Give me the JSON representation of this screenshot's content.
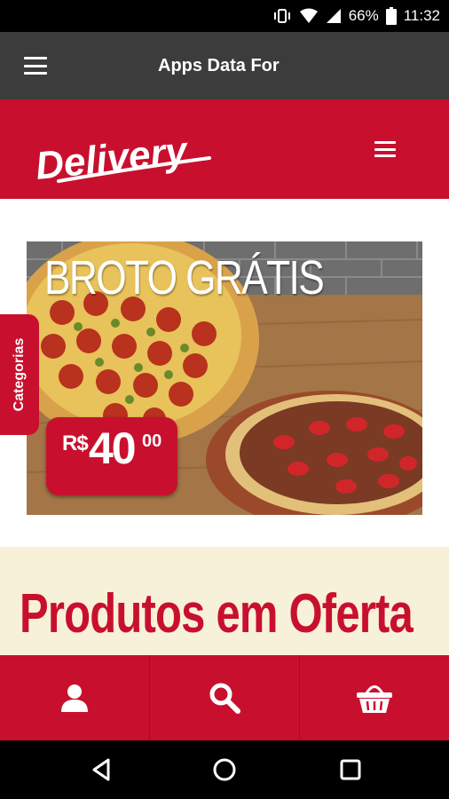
{
  "status_bar": {
    "battery": "66%",
    "time": "11:32"
  },
  "app_bar": {
    "title": "Apps Data For",
    "menu_icon": "hamburger-icon"
  },
  "site_header": {
    "logo_text": "Delivery",
    "menu_icon": "hamburger-icon"
  },
  "banner": {
    "title": "BROTO GRÁTIS",
    "price_currency": "R$",
    "price_integer": "40",
    "price_cents": "00"
  },
  "offers": {
    "title": "Produtos em Oferta"
  },
  "side_tab": {
    "label": "Categorias"
  },
  "bottom_bar": {
    "items": [
      {
        "icon": "user-icon"
      },
      {
        "icon": "search-icon"
      },
      {
        "icon": "basket-icon"
      }
    ]
  },
  "nav_bar": {
    "buttons": [
      "back-icon",
      "home-icon",
      "recents-icon"
    ]
  },
  "colors": {
    "brand_red": "#c8102e",
    "app_bar": "#3c3c3c",
    "offers_bg": "#f7f1d9"
  }
}
